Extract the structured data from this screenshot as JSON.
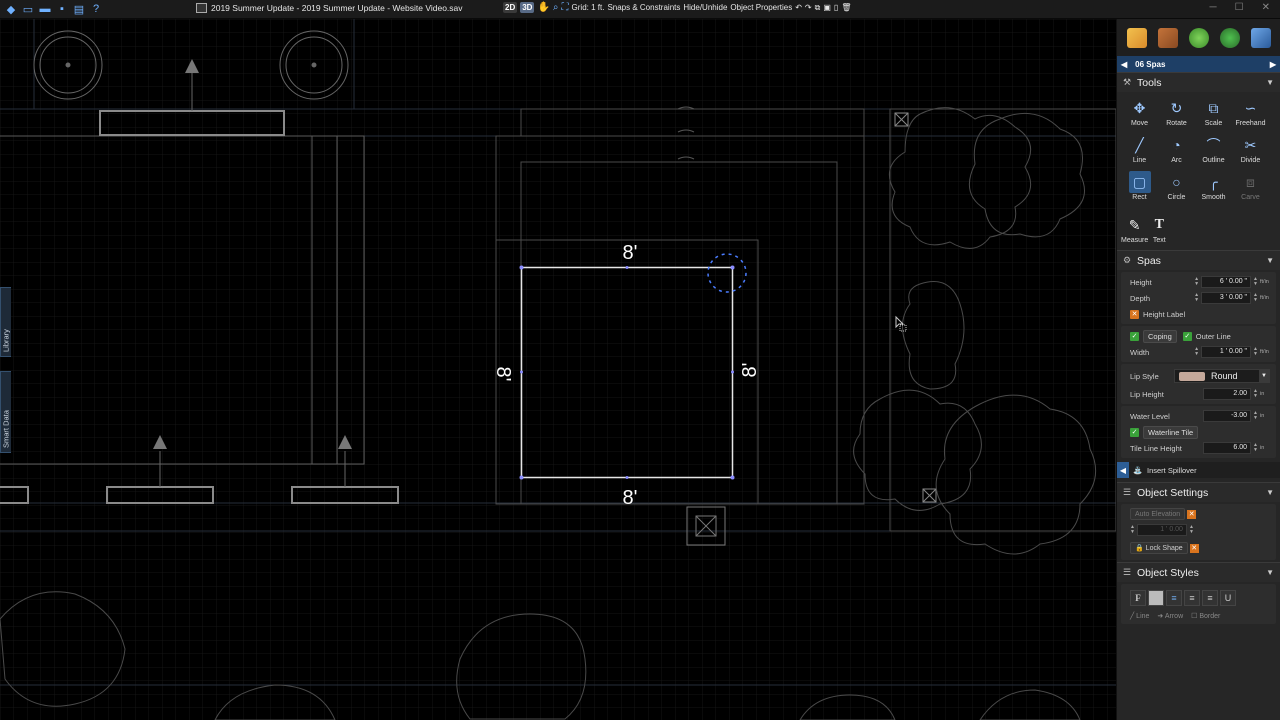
{
  "titlebar": {
    "title": "2019 Summer Update - 2019 Summer Update - Website Video.sav"
  },
  "viewtools": {
    "view2d": "2D",
    "view3d": "3D",
    "grid": "Grid: 1 ft.",
    "snaps": "Snaps & Constraints",
    "hide_unhide": "Hide/Unhide",
    "object_properties": "Object Properties"
  },
  "canvas": {
    "dim_top": "8'",
    "dim_bottom": "8'",
    "dim_left": "8'",
    "dim_right": "8'"
  },
  "sidetabs": {
    "library": "Library",
    "smart_data": "Smart Data"
  },
  "panel": {
    "breadcrumb": "06 Spas",
    "tools_header": "Tools",
    "tools": [
      {
        "label": "Move",
        "icon": "move-icon"
      },
      {
        "label": "Rotate",
        "icon": "rotate-icon"
      },
      {
        "label": "Scale",
        "icon": "scale-icon"
      },
      {
        "label": "Freehand",
        "icon": "freehand-icon"
      },
      {
        "label": "Line",
        "icon": "line-icon"
      },
      {
        "label": "Arc",
        "icon": "arc-icon"
      },
      {
        "label": "Outline",
        "icon": "outline-icon"
      },
      {
        "label": "Divide",
        "icon": "divide-icon"
      },
      {
        "label": "Rect",
        "icon": "rect-icon"
      },
      {
        "label": "Circle",
        "icon": "circle-icon"
      },
      {
        "label": "Smooth",
        "icon": "smooth-icon"
      },
      {
        "label": "Carve",
        "icon": "carve-icon"
      }
    ],
    "measure": "Measure",
    "text": "Text",
    "spas_header": "Spas",
    "height_label": "Height",
    "height_value": "6 ' 0.00 \"",
    "depth_label": "Depth",
    "depth_value": "3 ' 0.00 \"",
    "height_label_toggle": "Height Label",
    "coping": "Coping",
    "outer_line": "Outer Line",
    "width_label": "Width",
    "width_value": "1 ' 0.00 \"",
    "unit_ftin": "ft/in",
    "lip_style_label": "Lip Style",
    "lip_style_value": "Round",
    "lip_height_label": "Lip Height",
    "lip_height_value": "2.00",
    "water_level_label": "Water Level",
    "water_level_value": "-3.00",
    "waterline_tile": "Waterline Tile",
    "tile_line_height_label": "Tile Line Height",
    "tile_line_height_value": "6.00",
    "unit_in": "in",
    "insert_spillover": "Insert Spillover",
    "object_settings_header": "Object Settings",
    "auto_elevation": "Auto Elevation",
    "auto_elevation_value": "1 ' 0.00",
    "lock_shape": "Lock Shape",
    "object_styles_header": "Object Styles",
    "style_line": "Line",
    "style_arrow": "Arrow",
    "style_border": "Border"
  }
}
